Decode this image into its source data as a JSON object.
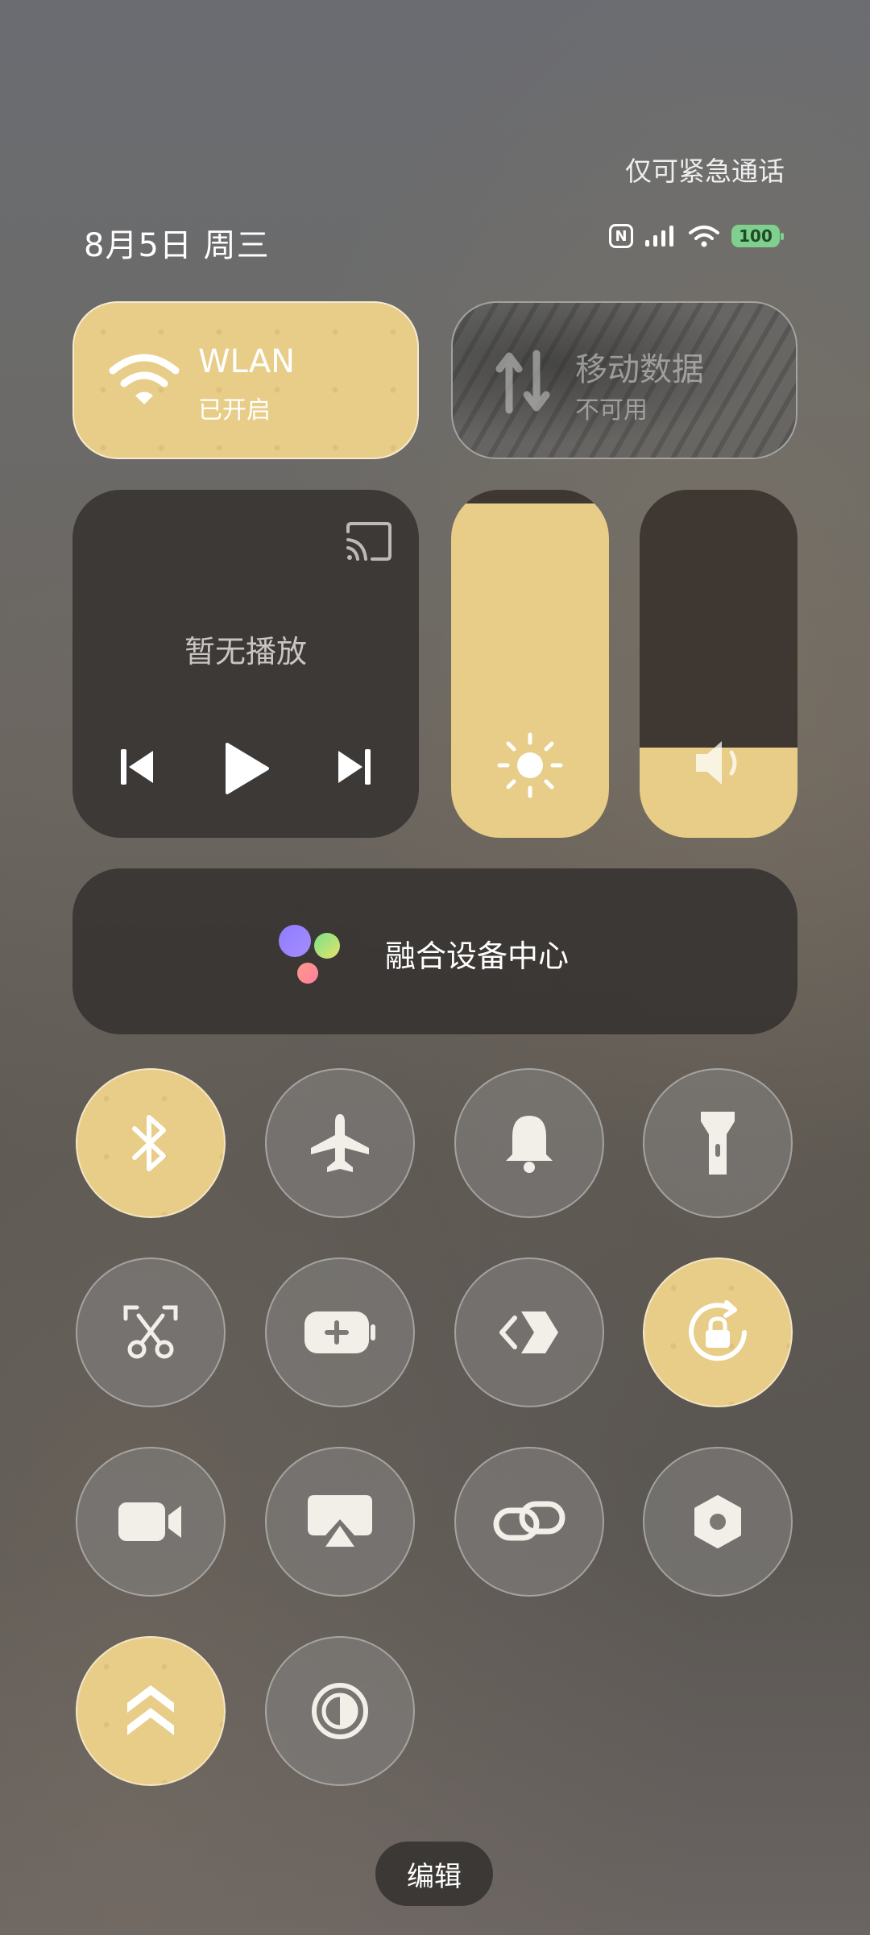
{
  "status_bar": {
    "emergency_text": "仅可紧急通话",
    "date": "8月5日 周三",
    "battery": "100",
    "icons": [
      "nfc-icon",
      "signal-icon",
      "wifi-icon",
      "battery-icon"
    ]
  },
  "tiles": {
    "wlan": {
      "title": "WLAN",
      "subtitle": "已开启",
      "active": true,
      "icon": "wifi-icon"
    },
    "mobile_data": {
      "title": "移动数据",
      "subtitle": "不可用",
      "active": false,
      "icon": "mobile-data-icon"
    }
  },
  "media": {
    "status": "暂无播放",
    "icons": [
      "cast-icon",
      "previous-icon",
      "play-icon",
      "next-icon"
    ]
  },
  "sliders": {
    "brightness": {
      "level": 0.96,
      "icon": "sun-icon"
    },
    "volume": {
      "level": 0.26,
      "icon": "speaker-icon"
    }
  },
  "fusion": {
    "label": "融合设备中心"
  },
  "toggles": [
    {
      "icon": "bluetooth-icon",
      "active": true
    },
    {
      "icon": "airplane-icon",
      "active": false
    },
    {
      "icon": "bell-icon",
      "active": false
    },
    {
      "icon": "flashlight-icon",
      "active": false
    },
    {
      "icon": "screenshot-scissors-icon",
      "active": false
    },
    {
      "icon": "battery-saver-icon",
      "active": false
    },
    {
      "icon": "code-share-icon",
      "active": false
    },
    {
      "icon": "rotation-lock-icon",
      "active": true
    },
    {
      "icon": "video-camera-icon",
      "active": false
    },
    {
      "icon": "screen-cast-icon",
      "active": false
    },
    {
      "icon": "link-icon",
      "active": false
    },
    {
      "icon": "settings-hex-icon",
      "active": false
    },
    {
      "icon": "performance-chevrons-icon",
      "active": true
    },
    {
      "icon": "dark-mode-icon",
      "active": false
    }
  ],
  "edit_label": "编辑",
  "colors": {
    "accent": "#e8cd88",
    "dark_tile": "#37342f",
    "battery": "#7fd08e"
  }
}
